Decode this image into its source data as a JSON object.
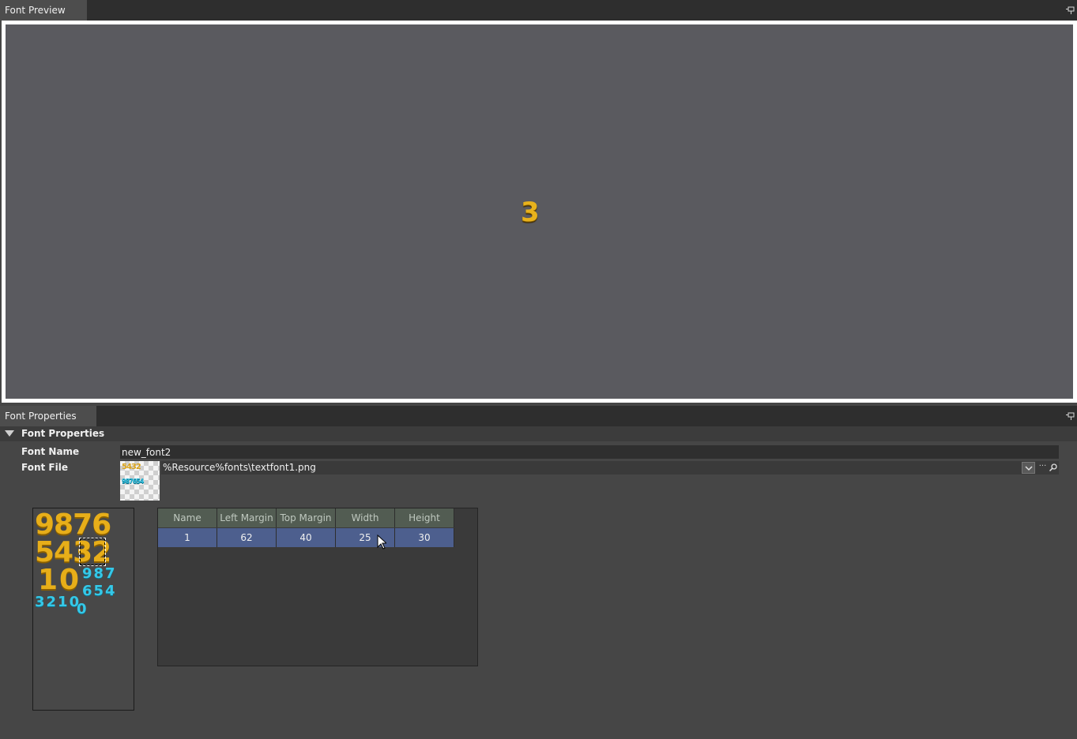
{
  "preview": {
    "tab_label": "Font Preview",
    "glyph_text": "3"
  },
  "properties": {
    "tab_label": "Font Properties",
    "section_title": "Font Properties",
    "font_name_label": "Font Name",
    "font_name_value": "new_font2",
    "font_file_label": "Font File",
    "font_file_value": "%Resource%fonts\\textfont1.png",
    "browse_label": "···"
  },
  "atlas": {
    "row1": "9876",
    "row2": "5432",
    "row3": "10",
    "row4a": "987",
    "row4b": "654",
    "row5": "3210",
    "row6": "0"
  },
  "glyph_table": {
    "columns": [
      "Name",
      "Left Margin",
      "Top Margin",
      "Width",
      "Height"
    ],
    "rows": [
      {
        "name": "1",
        "left_margin": "62",
        "top_margin": "40",
        "width": "25",
        "height": "30"
      }
    ]
  },
  "icons": {
    "pin": "pin-icon",
    "dropdown": "chevron-down-icon",
    "search": "search-icon",
    "collapse": "triangle-down-icon"
  },
  "colors": {
    "selection_row": "#4d5f8e",
    "header_cell": "#525c52",
    "glyph_gold": "#e8b21c",
    "glyph_cyan": "#35c8e8"
  }
}
